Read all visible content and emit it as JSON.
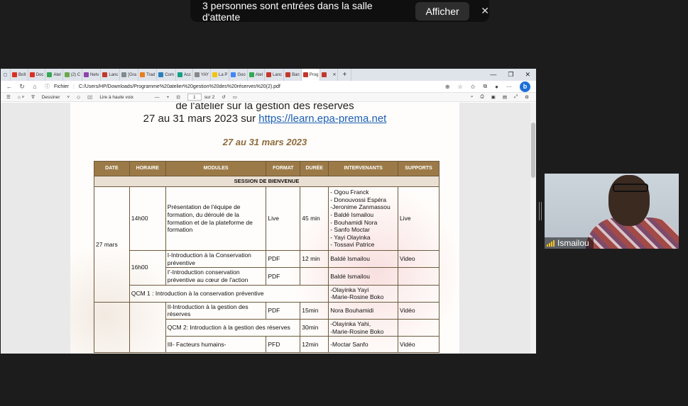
{
  "notification": {
    "message": "3 personnes sont entrées dans la salle d'attente",
    "button": "Afficher",
    "close": "✕"
  },
  "browser": {
    "tabs": [
      {
        "label": "Boît",
        "color": "#d93025"
      },
      {
        "label": "Doc",
        "color": "#d93025"
      },
      {
        "label": "Atel",
        "color": "#34a853"
      },
      {
        "label": "(2) C",
        "color": "#6aa84f"
      },
      {
        "label": "Netv",
        "color": "#8e44ad"
      },
      {
        "label": "Lanc",
        "color": "#c0392b"
      },
      {
        "label": "[Gra",
        "color": "#7f8c8d"
      },
      {
        "label": "Trad",
        "color": "#e67e22"
      },
      {
        "label": "Com",
        "color": "#2980b9"
      },
      {
        "label": "Acc",
        "color": "#16a085"
      },
      {
        "label": "YAY",
        "color": "#888888"
      },
      {
        "label": "La P",
        "color": "#f1c40f"
      },
      {
        "label": "Goo",
        "color": "#4285f4"
      },
      {
        "label": "Atel",
        "color": "#34a853"
      },
      {
        "label": "Lanc",
        "color": "#c0392b"
      },
      {
        "label": "Ban",
        "color": "#c0392b"
      },
      {
        "label": "Prog",
        "color": "#c0392b"
      },
      {
        "label": "",
        "color": "#c0392b"
      }
    ],
    "new_tab": "+",
    "address_prefix": "Fichier",
    "address": "C:/Users/HP/Downloads/Programme%20atelier%20gestion%20des%20réserves%20(2).pdf",
    "pdf_toolbar": {
      "draw": "Dessiner",
      "read_aloud": "Lire à haute voix",
      "page_current": "1",
      "page_total": "sur 2"
    }
  },
  "document": {
    "heading_line1": "de l'atelier sur la gestion des réserves",
    "heading_line2_prefix": "27 au 31 mars 2023 sur ",
    "heading_link": "https://learn.epa-prema.net",
    "date_subtitle": "27 au 31 mars 2023",
    "table": {
      "headers": [
        "DATE",
        "HORAIRE",
        "MODULES",
        "FORMAT",
        "DURÉE",
        "INTERVENANTS",
        "SUPPORTS"
      ],
      "session_title": "SESSION DE BIENVENUE",
      "date_cell": "27 mars",
      "row1": {
        "time": "14h00",
        "module": "Présentation de l'équipe de formation, du déroulé de la formation et de la plateforme de formation",
        "format": "Live",
        "duration": "45 min",
        "speakers": "- Ogou Franck\n- Donouvossi Espéra\n-Jeronime Zanmassou\n- Baldé Ismailou\n- Bouhamidi Nora\n- Sanfo Moctar\n- Yayi Olayinka\n- Tossavi Patrice",
        "support": "Live"
      },
      "time2": "16h00",
      "row2": {
        "module": "I-Introduction à la Conservation préventive",
        "format": "PDF",
        "duration": "12 min",
        "speakers": "Baldé Ismailou",
        "support": "Video"
      },
      "row3": {
        "module": "I'-Introduction conservation préventive au cœur de l'action",
        "format": "PDF",
        "duration": "",
        "speakers": "Baldé Ismailou",
        "support": ""
      },
      "qcm1": {
        "label": "QCM 1 : Introduction à la conservation préventive",
        "speakers": "-Olayinka Yayi\n-Marie-Rosine Boko"
      },
      "row4": {
        "module": "II-Introduction à la gestion des réserves",
        "format": "PDF",
        "duration": "15min",
        "speakers": "Nora Bouhamidi",
        "support": "Vidéo"
      },
      "qcm2": {
        "label": "QCM 2: Introduction à la gestion des réserves",
        "duration": "30min",
        "speakers": "-Olayinka Yahi,\n-Marie-Rosine Boko"
      },
      "row5": {
        "module": "III- Facteurs humains-",
        "format": "PFD",
        "duration": "12min",
        "speakers": "-Moctar Sanfo",
        "support": "Vidéo"
      }
    }
  },
  "video": {
    "name": "Ismailou"
  }
}
